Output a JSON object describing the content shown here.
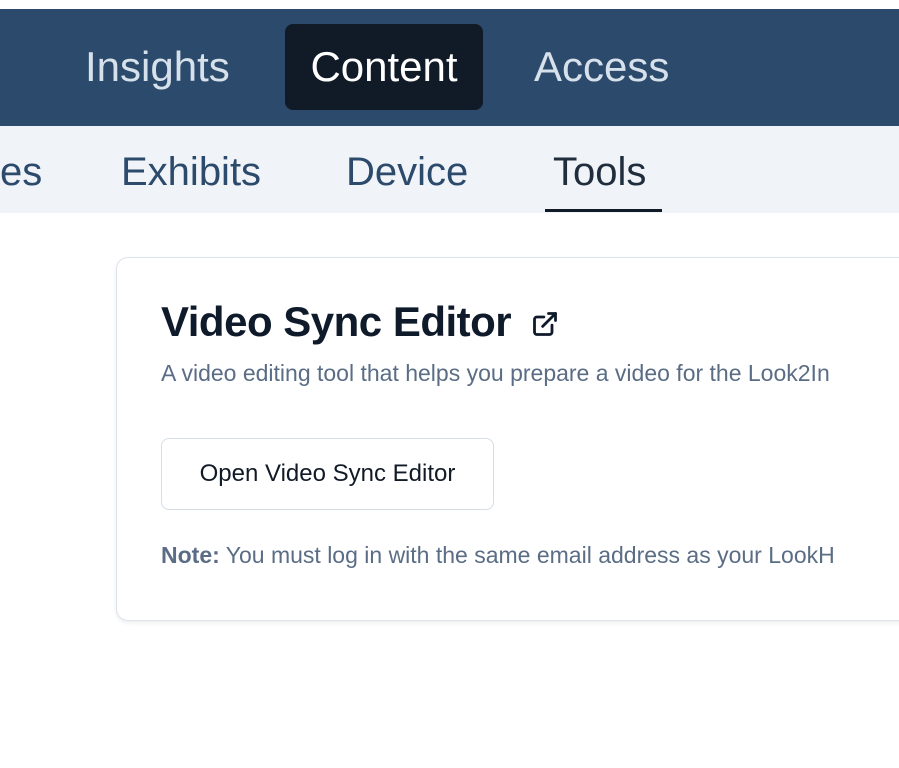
{
  "top_nav": {
    "tabs": [
      {
        "label": "Insights",
        "active": false
      },
      {
        "label": "Content",
        "active": true
      },
      {
        "label": "Access",
        "active": false
      }
    ]
  },
  "sub_nav": {
    "tabs": [
      {
        "label": "es",
        "active": false
      },
      {
        "label": "Exhibits",
        "active": false
      },
      {
        "label": "Device",
        "active": false
      },
      {
        "label": "Tools",
        "active": true
      }
    ]
  },
  "card": {
    "title": "Video Sync Editor",
    "title_icon": "external-link-icon",
    "description": "A video editing tool that helps you prepare a video for the Look2In",
    "button_label": "Open Video Sync Editor",
    "note_label": "Note:",
    "note_text": " You must log in with the same email address as your LookH"
  },
  "colors": {
    "topbar": "#2c4a6b",
    "active_tab": "#111a27",
    "subbar": "#f0f4f9",
    "muted_text": "#5a6d85"
  }
}
